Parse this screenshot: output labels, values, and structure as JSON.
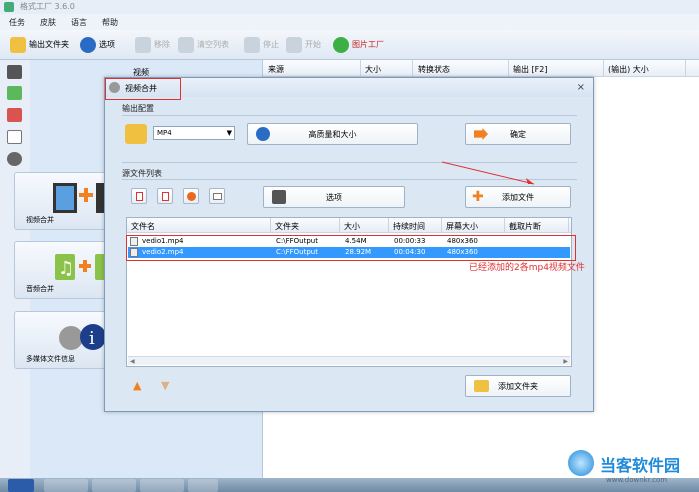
{
  "window": {
    "title": "格式工厂 3.6.0"
  },
  "menu": [
    "任务",
    "皮肤",
    "语言",
    "帮助"
  ],
  "toolbar": {
    "output_folder": "输出文件夹",
    "options": "选项",
    "remove": "移除",
    "clear_list": "清空列表",
    "stop": "停止",
    "start": "开始",
    "picture_factory": "图片工厂"
  },
  "left_tab": "视频",
  "categories": [
    {
      "label": "视频合并"
    },
    {
      "label": "音频合并"
    },
    {
      "label": "多媒体文件信息"
    }
  ],
  "main_list_headers": [
    "来源",
    "大小",
    "转换状态",
    "输出 [F2]",
    "(输出) 大小"
  ],
  "dialog": {
    "title": "视频合并",
    "close": "×",
    "output_config_label": "输出配置",
    "format_value": "MP4",
    "quality_button": "高质量和大小",
    "ok_button": "确定",
    "source_list_label": "源文件列表",
    "options_button": "选项",
    "add_file_button": "添加文件",
    "add_folder_button": "添加文件夹",
    "columns": [
      "文件名",
      "文件夹",
      "大小",
      "持续时间",
      "屏幕大小",
      "截取片断"
    ],
    "files": [
      {
        "name": "vedio1.mp4",
        "folder": "C:\\FFOutput",
        "size": "4.54M",
        "duration": "00:00:33",
        "screen": "480x360",
        "clip": ""
      },
      {
        "name": "vedio2.mp4",
        "folder": "C:\\FFOutput",
        "size": "28.92M",
        "duration": "00:04:30",
        "screen": "480x360",
        "clip": ""
      }
    ]
  },
  "annotation": "已经添加的2各mp4视频文件",
  "watermark": {
    "name": "当客软件园",
    "url": "www.downkr.com"
  },
  "colors": {
    "selection": "#3399ff",
    "annotation": "#e03030",
    "watermark": "#1f8ad8"
  }
}
